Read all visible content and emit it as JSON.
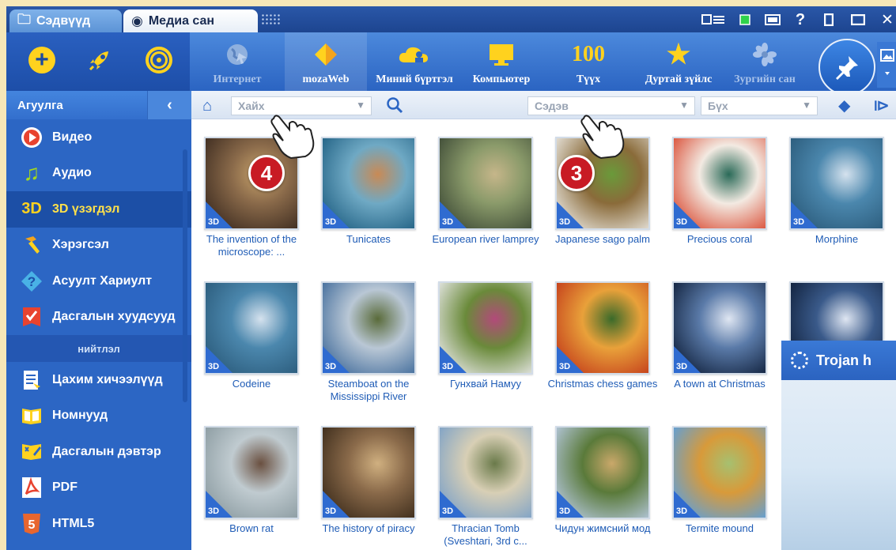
{
  "tabs": [
    {
      "label": "Сэдвүүд",
      "icon": "folder-icon"
    },
    {
      "label": "Медиа сан",
      "icon": "media-icon"
    }
  ],
  "toolbar": {
    "items": [
      {
        "label": "Интернет",
        "icon": "globe-icon",
        "state": "disabled"
      },
      {
        "label": "mozaWeb",
        "icon": "mozaweb-icon",
        "state": "active"
      },
      {
        "label": "Миний бүртгэл",
        "icon": "cloud-user-icon",
        "state": "normal"
      },
      {
        "label": "Компьютер",
        "icon": "monitor-icon",
        "state": "normal"
      },
      {
        "label": "Түүх",
        "icon": "history-100-icon",
        "icon_text": "100",
        "state": "normal"
      },
      {
        "label": "Дуртай зүйлс",
        "icon": "star-icon",
        "state": "normal"
      },
      {
        "label": "Зургийн сан",
        "icon": "gallery-icon",
        "state": "disabled"
      }
    ]
  },
  "sidebar": {
    "header": "Агуулга",
    "items": [
      {
        "label": "Видео",
        "icon": "play-icon",
        "icon_text": "▶",
        "icon_color": "#e8432f"
      },
      {
        "label": "Аудио",
        "icon": "music-note-icon",
        "icon_text": "♫",
        "icon_color": "#f4d21c"
      },
      {
        "label": "3D үзэгдэл",
        "icon": "three-d-icon",
        "icon_text": "3D",
        "icon_color": "#ffd21e",
        "selected": true
      },
      {
        "label": "Хэрэгсэл",
        "icon": "hammer-icon",
        "icon_text": "⚒",
        "icon_color": "#f3a41c"
      },
      {
        "label": "Асуулт Хариулт",
        "icon": "question-icon",
        "icon_text": "?",
        "icon_color": "#49b2e6"
      },
      {
        "label": "Дасгалын хуудсууд",
        "icon": "check-sheet-icon",
        "icon_text": "✔",
        "icon_color": "#e8432f"
      }
    ],
    "section": "нийтлэл",
    "items2": [
      {
        "label": "Цахим хичээлүүд",
        "icon": "lesson-icon",
        "icon_text": "▤",
        "icon_color": "#f4d21c"
      },
      {
        "label": "Номнууд",
        "icon": "book-icon",
        "icon_text": "▭",
        "icon_color": "#f4d21c"
      },
      {
        "label": "Дасгалын дэвтэр",
        "icon": "workbook-icon",
        "icon_text": "✎",
        "icon_color": "#f4d21c"
      },
      {
        "label": "PDF",
        "icon": "pdf-icon",
        "icon_text": "⅄",
        "icon_color": "#e8432f"
      },
      {
        "label": "HTML5",
        "icon": "html5-icon",
        "icon_text": "5",
        "icon_color": "#e8662f"
      }
    ]
  },
  "filters": {
    "search_placeholder": "Хайх",
    "topic_value": "Сэдэв",
    "scope_value": "Бүх"
  },
  "grid": {
    "badge": "3D",
    "items": [
      {
        "label": "The invention of the microscope: ...",
        "palette": [
          "#3b2a1f",
          "#8a6a4a",
          "#c9a46c"
        ]
      },
      {
        "label": "Tunicates",
        "palette": [
          "#1f5f82",
          "#6fa9c4",
          "#c98a55"
        ]
      },
      {
        "label": "European river lamprey",
        "palette": [
          "#3d4a36",
          "#8a9a6a",
          "#c6b68a"
        ]
      },
      {
        "label": "Japanese sago palm",
        "palette": [
          "#e9e6df",
          "#8a6b3a",
          "#6a9a3a"
        ]
      },
      {
        "label": "Precious coral",
        "palette": [
          "#d94a32",
          "#f3eae2",
          "#2a6a58"
        ]
      },
      {
        "label": "Morphine",
        "palette": [
          "#2a5a7a",
          "#4b87ad",
          "#d5e2ee"
        ]
      },
      {
        "label": "Codeine",
        "palette": [
          "#2a5a7a",
          "#4b87ad",
          "#d5e2ee"
        ]
      },
      {
        "label": "Steamboat on the Mississippi River",
        "palette": [
          "#3f6a9a",
          "#b9c7d5",
          "#5a6b3a"
        ]
      },
      {
        "label": "Гунхвай Намуу",
        "palette": [
          "#e8e8e8",
          "#6a8a3a",
          "#b24a7a"
        ]
      },
      {
        "label": "Christmas chess games",
        "palette": [
          "#c23a1a",
          "#e9a13a",
          "#3a6a2a"
        ]
      },
      {
        "label": "A town at Christmas",
        "palette": [
          "#0f1f3a",
          "#5a7aa8",
          "#dfe6f2"
        ]
      },
      {
        "label": "",
        "palette": [
          "#0f1f3a",
          "#3a5a8a",
          "#dfe6f2"
        ]
      },
      {
        "label": "Brown rat",
        "palette": [
          "#8a9aa0",
          "#c0cbd0",
          "#6a5040"
        ]
      },
      {
        "label": "The history of piracy",
        "palette": [
          "#3a2a1a",
          "#8a6a4a",
          "#d0b080"
        ]
      },
      {
        "label": "Thracian Tomb (Sveshtari, 3rd c...",
        "palette": [
          "#7aa0c8",
          "#d8cfb5",
          "#6a7a4a"
        ]
      },
      {
        "label": "Чидун жимсний мод",
        "palette": [
          "#b7c9e0",
          "#5a7a3a",
          "#caa86a"
        ]
      },
      {
        "label": "Termite mound",
        "palette": [
          "#5aa0e0",
          "#d89a3a",
          "#a6c070"
        ]
      }
    ]
  },
  "callouts": {
    "search": "4",
    "topic": "3"
  },
  "popup": {
    "title": "Trojan h"
  }
}
